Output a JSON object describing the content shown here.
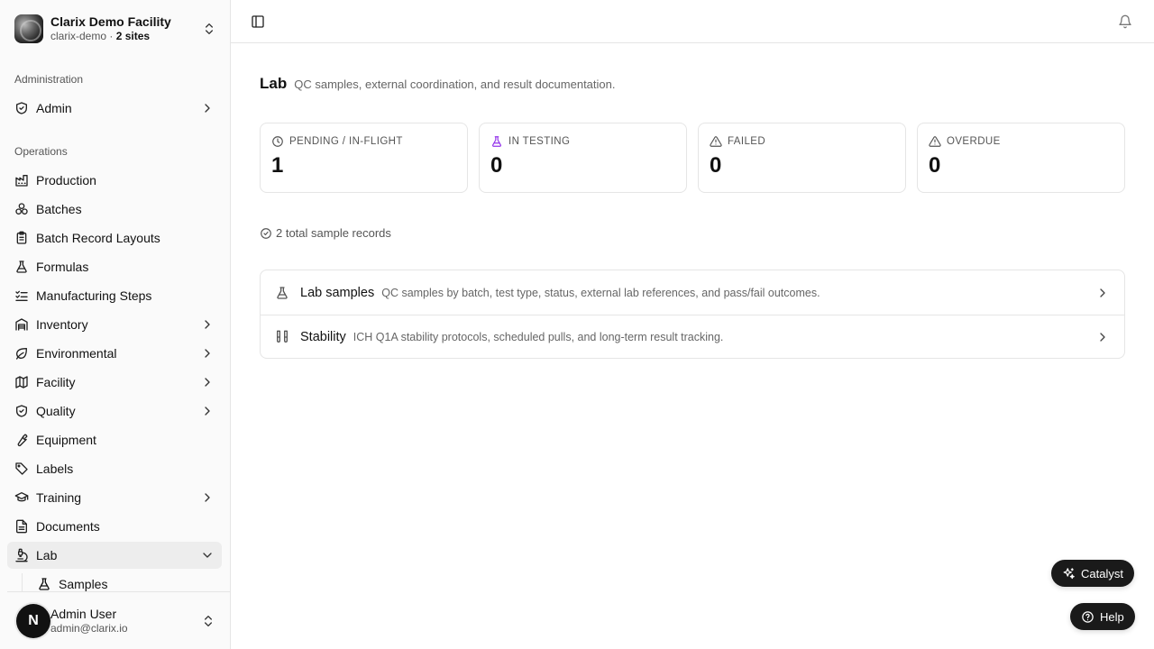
{
  "org": {
    "name": "Clarix Demo Facility",
    "slug": "clarix-demo",
    "sep": " · ",
    "sites": "2 sites"
  },
  "sidebar": {
    "sections": {
      "administration": "Administration",
      "operations": "Operations"
    },
    "admin": {
      "label": "Admin",
      "icon": "shield-check-icon"
    },
    "items": [
      {
        "label": "Production",
        "icon": "factory-icon"
      },
      {
        "label": "Batches",
        "icon": "boxes-icon"
      },
      {
        "label": "Batch Record Layouts",
        "icon": "clipboard-icon"
      },
      {
        "label": "Formulas",
        "icon": "flask-icon"
      },
      {
        "label": "Manufacturing Steps",
        "icon": "list-checks-icon"
      },
      {
        "label": "Inventory",
        "icon": "warehouse-icon"
      },
      {
        "label": "Environmental",
        "icon": "leaf-icon"
      },
      {
        "label": "Facility",
        "icon": "map-icon"
      },
      {
        "label": "Quality",
        "icon": "shield-check-icon"
      },
      {
        "label": "Equipment",
        "icon": "wrench-icon"
      },
      {
        "label": "Labels",
        "icon": "tag-icon"
      },
      {
        "label": "Training",
        "icon": "graduation-cap-icon"
      },
      {
        "label": "Documents",
        "icon": "file-text-icon"
      },
      {
        "label": "Lab",
        "icon": "microscope-icon"
      }
    ],
    "sub_items": [
      {
        "label": "Samples",
        "icon": "flask-icon"
      }
    ]
  },
  "user": {
    "initial": "N",
    "name": "Admin User",
    "email": "admin@clarix.io"
  },
  "page": {
    "title": "Lab",
    "description": "QC samples, external coordination, and result documentation."
  },
  "stats": [
    {
      "label": "PENDING / IN-FLIGHT",
      "value": "1",
      "icon": "clock-icon",
      "color": "#555555"
    },
    {
      "label": "IN TESTING",
      "value": "0",
      "icon": "flask-icon",
      "color": "#9333ea"
    },
    {
      "label": "FAILED",
      "value": "0",
      "icon": "alert-triangle-icon",
      "color": "#555555"
    },
    {
      "label": "OVERDUE",
      "value": "0",
      "icon": "alert-triangle-icon",
      "color": "#555555"
    }
  ],
  "total_records": "2 total sample records",
  "links": [
    {
      "name": "Lab samples",
      "description": "QC samples by batch, test type, status, external lab references, and pass/fail outcomes.",
      "icon": "flask-icon"
    },
    {
      "name": "Stability",
      "description": "ICH Q1A stability protocols, scheduled pulls, and long-term result tracking.",
      "icon": "test-tubes-icon"
    }
  ],
  "floating": {
    "catalyst": "Catalyst",
    "help": "Help"
  },
  "colors": {
    "accent_purple": "#9333ea",
    "dark": "#1a1a1a"
  }
}
